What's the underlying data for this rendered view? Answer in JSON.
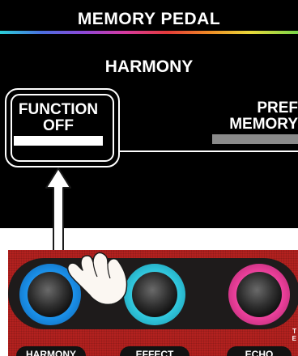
{
  "screen": {
    "title": "MEMORY PEDAL",
    "parameter": "HARMONY",
    "left_slot": {
      "line1": "FUNCTION",
      "line2": "OFF"
    },
    "right_slot": {
      "line1": "PREF",
      "line2": "MEMORY"
    }
  },
  "pedals": [
    {
      "label": "HARMONY",
      "ring_color": "#1a8fe8"
    },
    {
      "label": "EFFECT",
      "ring_color": "#30c6dc"
    },
    {
      "label": "ECHO",
      "ring_color": "#ea3f9a"
    }
  ],
  "side_text": {
    "line1": "T",
    "line2": "E"
  }
}
